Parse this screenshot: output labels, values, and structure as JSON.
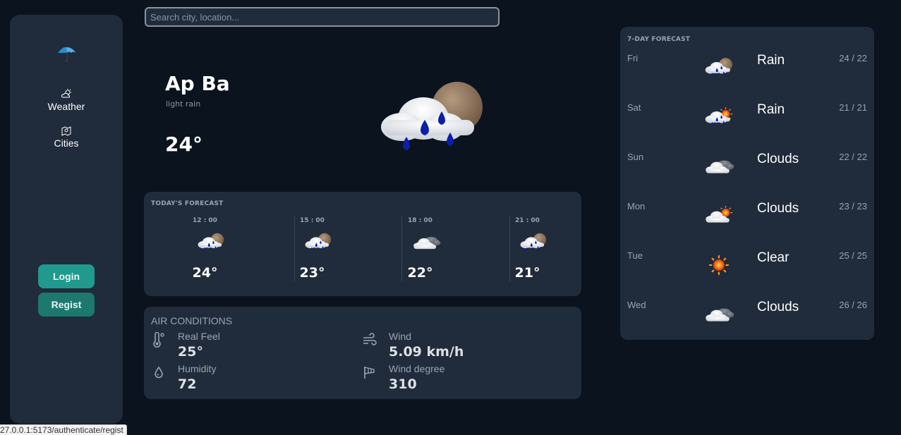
{
  "sidebar": {
    "logo_icon": "umbrella-icon",
    "nav": [
      {
        "label": "Weather",
        "icon": "cloud-sun-icon"
      },
      {
        "label": "Cities",
        "icon": "map-icon"
      }
    ],
    "login_label": "Login",
    "regist_label": "Regist"
  },
  "search": {
    "placeholder": "Search city, location..."
  },
  "current": {
    "city": "Ap Ba",
    "description": "light rain",
    "temperature": "24°",
    "icon": "rain-night-icon"
  },
  "today": {
    "title": "TODAY'S FORECAST",
    "hours": [
      {
        "time": "12 : 00",
        "temp": "24°",
        "icon": "rain-night-icon"
      },
      {
        "time": "15 : 00",
        "temp": "23°",
        "icon": "rain-night-icon"
      },
      {
        "time": "18 : 00",
        "temp": "22°",
        "icon": "cloud-night-icon"
      },
      {
        "time": "21 : 00",
        "temp": "21°",
        "icon": "rain-night-icon"
      }
    ]
  },
  "air": {
    "title": "AIR CONDITIONS",
    "real_feel": {
      "label": "Real Feel",
      "value": "25°",
      "icon": "thermometer-icon"
    },
    "humidity": {
      "label": "Humidity",
      "value": "72",
      "icon": "droplet-icon"
    },
    "wind": {
      "label": "Wind",
      "value": "5.09 km/h",
      "icon": "wind-icon"
    },
    "wind_degree": {
      "label": "Wind degree",
      "value": "310",
      "icon": "windsock-icon"
    }
  },
  "week": {
    "title": "7-DAY FORECAST",
    "days": [
      {
        "day": "Fri",
        "condition": "Rain",
        "range": "24 / 22",
        "icon": "rain-night-icon"
      },
      {
        "day": "Sat",
        "condition": "Rain",
        "range": "21 / 21",
        "icon": "rain-day-icon"
      },
      {
        "day": "Sun",
        "condition": "Clouds",
        "range": "22 / 22",
        "icon": "cloud-night-icon"
      },
      {
        "day": "Mon",
        "condition": "Clouds",
        "range": "23 / 23",
        "icon": "cloud-day-icon"
      },
      {
        "day": "Tue",
        "condition": "Clear",
        "range": "25 / 25",
        "icon": "sun-icon"
      },
      {
        "day": "Wed",
        "condition": "Clouds",
        "range": "26 / 26",
        "icon": "cloud-night-icon"
      }
    ]
  },
  "status_url": "27.0.0.1:5173/authenticate/regist",
  "colors": {
    "background": "#0b131e",
    "panel": "#202b3b",
    "login_button": "#1f9a8c",
    "regist_button": "#1d786e"
  }
}
